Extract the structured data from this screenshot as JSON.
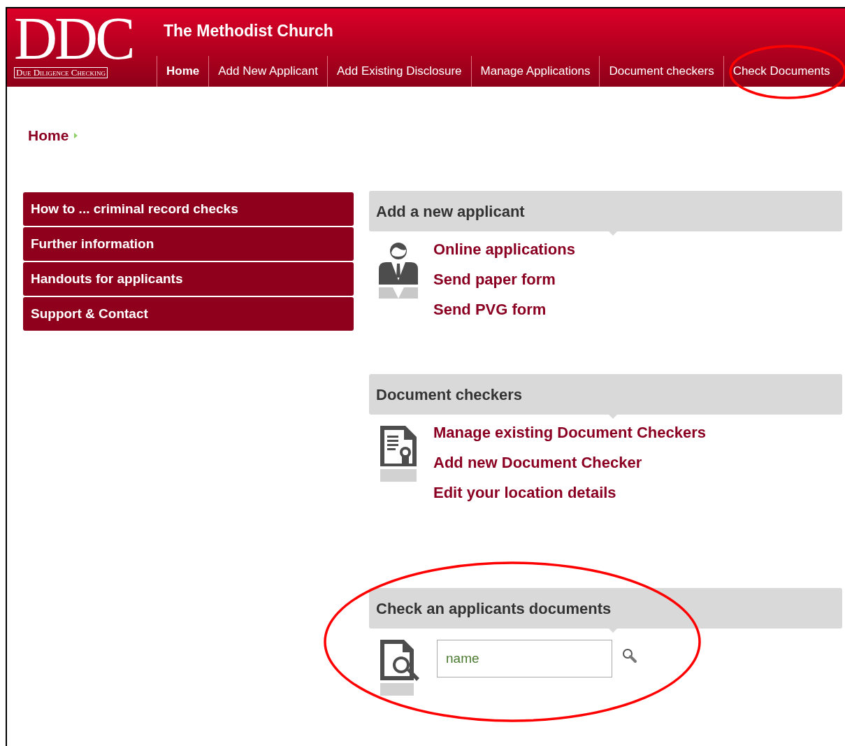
{
  "header": {
    "logo": {
      "letters": "DDC",
      "tagline": "Due Diligence Checking"
    },
    "title": "The Methodist Church"
  },
  "nav": [
    {
      "label": "Home",
      "selected": true
    },
    {
      "label": "Add New Applicant",
      "selected": false
    },
    {
      "label": "Add Existing Disclosure",
      "selected": false
    },
    {
      "label": "Manage Applications",
      "selected": false
    },
    {
      "label": "Document checkers",
      "selected": false
    },
    {
      "label": "Check Documents",
      "selected": false
    }
  ],
  "breadcrumb": [
    "Home"
  ],
  "sidebar": {
    "items": [
      {
        "label": "How to ... criminal record checks"
      },
      {
        "label": "Further information"
      },
      {
        "label": "Handouts for applicants"
      },
      {
        "label": "Support & Contact"
      }
    ]
  },
  "panels": [
    {
      "kind": "links",
      "title": "Add a new applicant",
      "links": [
        "Online applications",
        "Send paper form",
        "Send PVG form"
      ]
    },
    {
      "kind": "links",
      "title": "Document checkers",
      "links": [
        "Manage existing Document Checkers",
        "Add new Document Checker",
        "Edit your location details"
      ]
    },
    {
      "kind": "search",
      "title": "Check an applicants documents",
      "search": {
        "placeholder": "name"
      }
    }
  ],
  "annotations": [
    {
      "kind": "ellipse"
    },
    {
      "kind": "ellipse"
    }
  ]
}
